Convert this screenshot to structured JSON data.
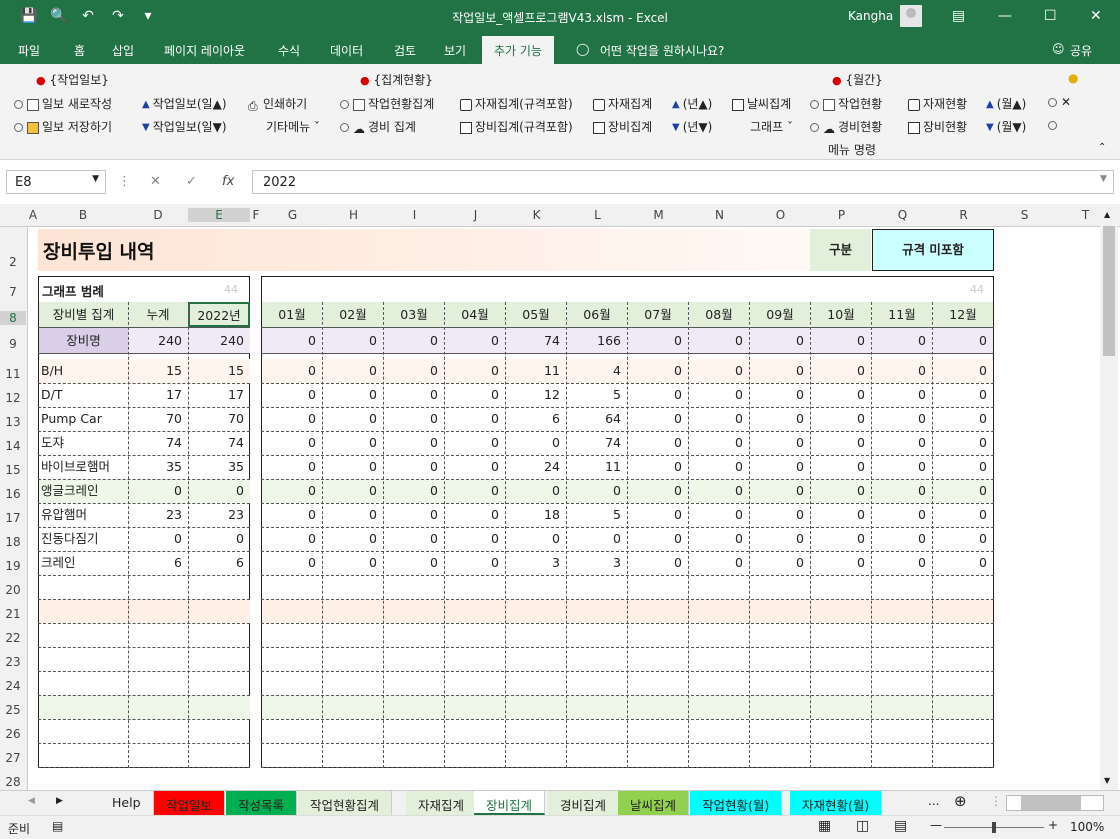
{
  "window": {
    "title": "작업일보_액셀프로그램V43.xlsm  -  Excel",
    "user": "Kangha"
  },
  "tabs": [
    "파일",
    "홈",
    "삽입",
    "페이지 레이아웃",
    "수식",
    "데이터",
    "검토",
    "보기",
    "추가 기능"
  ],
  "active_tab": "추가 기능",
  "tell_me": "어떤 작업을 원하시나요?",
  "share": "공유",
  "ribbon": {
    "g1": {
      "title": "{작업일보}",
      "b1": "일보 새로작성",
      "b2": "일보 저장하기",
      "b3": "작업일보(일▲)",
      "b4": "작업일보(일▼)",
      "b5": "인쇄하기",
      "b6": "기타메뉴"
    },
    "g2": {
      "title": "{집계현황}",
      "b1": "작업현황집계",
      "b2": "경비 집계",
      "b3": "자재집계(규격포함)",
      "b4": "장비집계(규격포함)",
      "b5": "자재집계",
      "b6": "장비집계",
      "b7": "(년▲)",
      "b8": "(년▼)",
      "b9": "날씨집계",
      "b10": "그래프"
    },
    "g3": {
      "title": "{월간}",
      "b1": "작업현황",
      "b2": "경비현황",
      "b3": "자재현황",
      "b4": "장비현황",
      "b5": "(월▲)",
      "b6": "(월▼)"
    },
    "footer": "메뉴 명령"
  },
  "formula": {
    "cell": "E8",
    "value": "2022"
  },
  "columns": [
    "A",
    "B",
    "D",
    "E",
    "F",
    "G",
    "H",
    "I",
    "J",
    "K",
    "L",
    "M",
    "N",
    "O",
    "P",
    "Q",
    "R",
    "S",
    "T"
  ],
  "rows": [
    "2",
    "7",
    "8",
    "9",
    "11",
    "12",
    "13",
    "14",
    "15",
    "16",
    "17",
    "18",
    "19",
    "20",
    "21",
    "22",
    "23",
    "24",
    "25",
    "26",
    "27",
    "28"
  ],
  "sheet": {
    "title": "장비투입 내역",
    "category_label": "구분",
    "category_value": "규격 미포함",
    "legend_label": "그래프 범례",
    "legend_num": "44",
    "right_num": "44",
    "hdr_item": "장비별 집계",
    "hdr_total": "누계",
    "hdr_year": "2022년",
    "months": [
      "01월",
      "02월",
      "03월",
      "04월",
      "05월",
      "06월",
      "07월",
      "08월",
      "09월",
      "10월",
      "11월",
      "12월"
    ],
    "total_label": "장비명",
    "total_cum": "240",
    "total_year": "240",
    "total_months": [
      "0",
      "0",
      "0",
      "0",
      "74",
      "166",
      "0",
      "0",
      "0",
      "0",
      "0",
      "0"
    ],
    "items": [
      {
        "name": "B/H",
        "cum": "15",
        "year": "15",
        "m": [
          "0",
          "0",
          "0",
          "0",
          "11",
          "4",
          "0",
          "0",
          "0",
          "0",
          "0",
          "0"
        ]
      },
      {
        "name": "D/T",
        "cum": "17",
        "year": "17",
        "m": [
          "0",
          "0",
          "0",
          "0",
          "12",
          "5",
          "0",
          "0",
          "0",
          "0",
          "0",
          "0"
        ]
      },
      {
        "name": "Pump Car",
        "cum": "70",
        "year": "70",
        "m": [
          "0",
          "0",
          "0",
          "0",
          "6",
          "64",
          "0",
          "0",
          "0",
          "0",
          "0",
          "0"
        ]
      },
      {
        "name": "도쟈",
        "cum": "74",
        "year": "74",
        "m": [
          "0",
          "0",
          "0",
          "0",
          "0",
          "74",
          "0",
          "0",
          "0",
          "0",
          "0",
          "0"
        ]
      },
      {
        "name": "바이브로햄머",
        "cum": "35",
        "year": "35",
        "m": [
          "0",
          "0",
          "0",
          "0",
          "24",
          "11",
          "0",
          "0",
          "0",
          "0",
          "0",
          "0"
        ]
      },
      {
        "name": "앵글크레인",
        "cum": "0",
        "year": "0",
        "m": [
          "0",
          "0",
          "0",
          "0",
          "0",
          "0",
          "0",
          "0",
          "0",
          "0",
          "0",
          "0"
        ]
      },
      {
        "name": "유압햄머",
        "cum": "23",
        "year": "23",
        "m": [
          "0",
          "0",
          "0",
          "0",
          "18",
          "5",
          "0",
          "0",
          "0",
          "0",
          "0",
          "0"
        ]
      },
      {
        "name": "진동다짐기",
        "cum": "0",
        "year": "0",
        "m": [
          "0",
          "0",
          "0",
          "0",
          "0",
          "0",
          "0",
          "0",
          "0",
          "0",
          "0",
          "0"
        ]
      },
      {
        "name": "크레인",
        "cum": "6",
        "year": "6",
        "m": [
          "0",
          "0",
          "0",
          "0",
          "3",
          "3",
          "0",
          "0",
          "0",
          "0",
          "0",
          "0"
        ]
      }
    ]
  },
  "sheet_tabs": [
    {
      "label": "Help",
      "color": "#f1f1f1"
    },
    {
      "label": "작업일보",
      "color": "#ff0000"
    },
    {
      "label": "작성목록",
      "color": "#00b050"
    },
    {
      "label": "작업현황집계",
      "color": "#e2efda"
    },
    {
      "label": "자재집계",
      "color": "#e2efda"
    },
    {
      "label": "장비집계",
      "color": "#ffffff"
    },
    {
      "label": "경비집계",
      "color": "#e2efda"
    },
    {
      "label": "날씨집계",
      "color": "#92d050"
    },
    {
      "label": "작업현황(월)",
      "color": "#00ffff"
    },
    {
      "label": "자재현황(월)",
      "color": "#00ffff"
    }
  ],
  "status": {
    "ready": "준비",
    "zoom": "100%",
    "more": "..."
  }
}
